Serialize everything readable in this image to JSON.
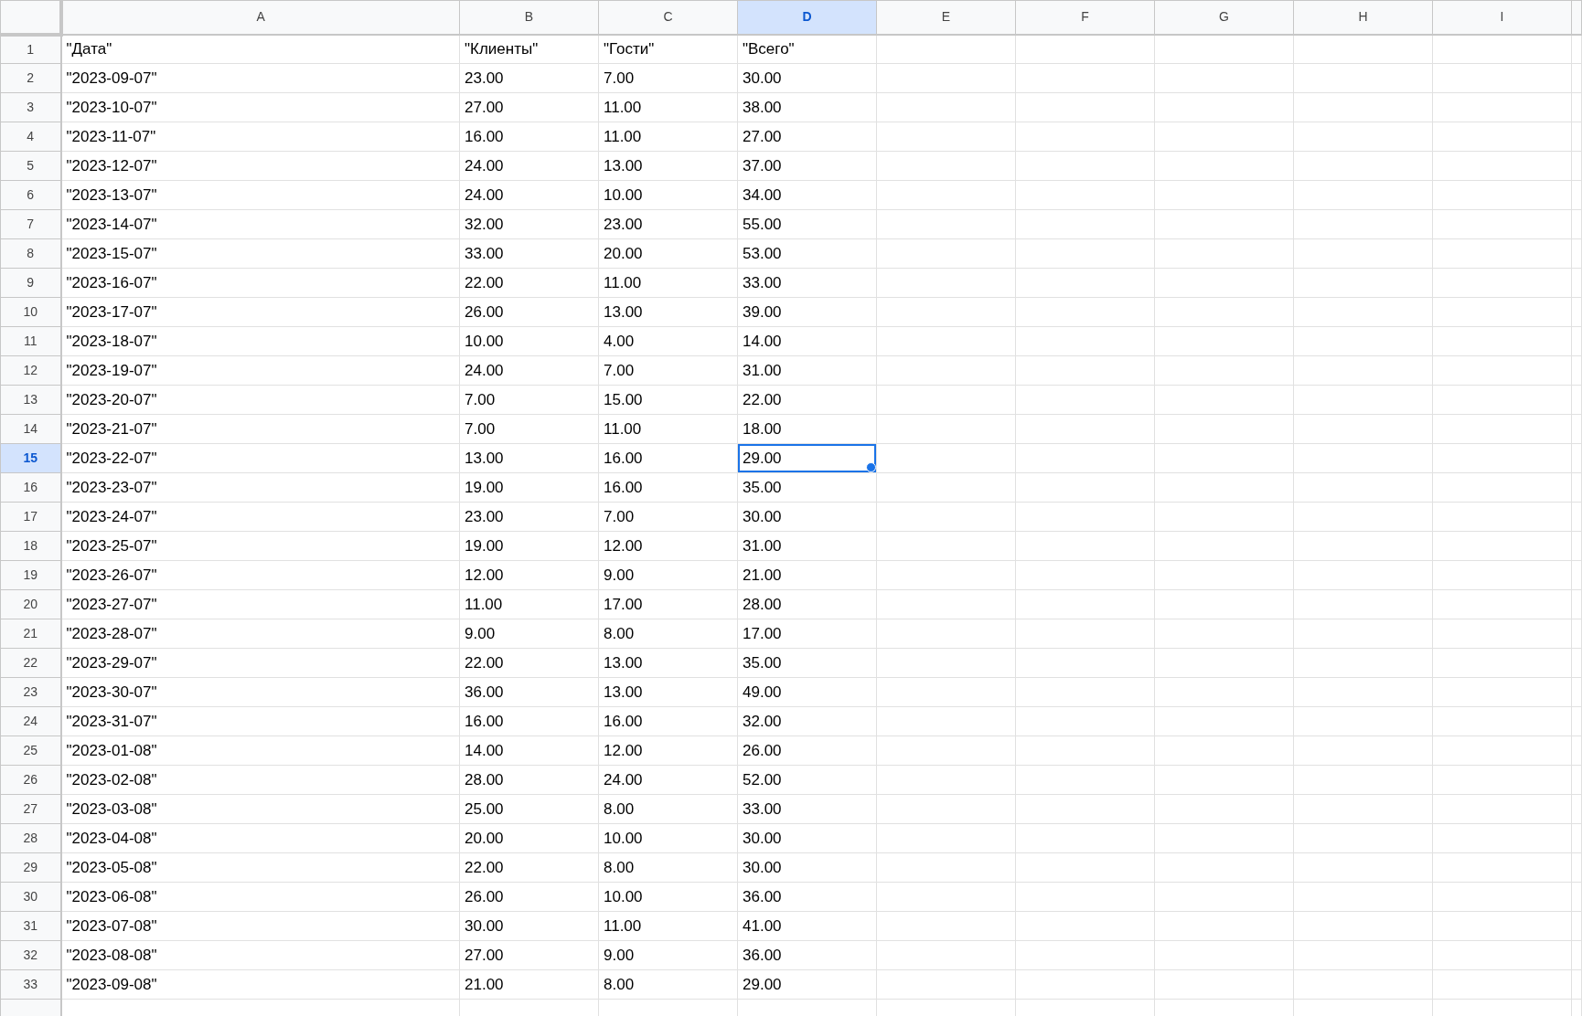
{
  "columns": [
    {
      "label": "A",
      "selected": false
    },
    {
      "label": "B",
      "selected": false
    },
    {
      "label": "C",
      "selected": false
    },
    {
      "label": "D",
      "selected": true
    },
    {
      "label": "E",
      "selected": false
    },
    {
      "label": "F",
      "selected": false
    },
    {
      "label": "G",
      "selected": false
    },
    {
      "label": "H",
      "selected": false
    },
    {
      "label": "I",
      "selected": false
    }
  ],
  "rows": [
    {
      "number": "1",
      "selected": false,
      "cells": [
        "\"Дата\"",
        "\"Клиенты\"",
        "\"Гости\"",
        "\"Всего\""
      ]
    },
    {
      "number": "2",
      "selected": false,
      "cells": [
        "\"2023-09-07\"",
        "23.00",
        "7.00",
        "30.00"
      ]
    },
    {
      "number": "3",
      "selected": false,
      "cells": [
        "\"2023-10-07\"",
        "27.00",
        "11.00",
        "38.00"
      ]
    },
    {
      "number": "4",
      "selected": false,
      "cells": [
        "\"2023-11-07\"",
        "16.00",
        "11.00",
        "27.00"
      ]
    },
    {
      "number": "5",
      "selected": false,
      "cells": [
        "\"2023-12-07\"",
        "24.00",
        "13.00",
        "37.00"
      ]
    },
    {
      "number": "6",
      "selected": false,
      "cells": [
        "\"2023-13-07\"",
        "24.00",
        "10.00",
        "34.00"
      ]
    },
    {
      "number": "7",
      "selected": false,
      "cells": [
        "\"2023-14-07\"",
        "32.00",
        "23.00",
        "55.00"
      ]
    },
    {
      "number": "8",
      "selected": false,
      "cells": [
        "\"2023-15-07\"",
        "33.00",
        "20.00",
        "53.00"
      ]
    },
    {
      "number": "9",
      "selected": false,
      "cells": [
        "\"2023-16-07\"",
        "22.00",
        "11.00",
        "33.00"
      ]
    },
    {
      "number": "10",
      "selected": false,
      "cells": [
        "\"2023-17-07\"",
        "26.00",
        "13.00",
        "39.00"
      ]
    },
    {
      "number": "11",
      "selected": false,
      "cells": [
        "\"2023-18-07\"",
        "10.00",
        "4.00",
        "14.00"
      ]
    },
    {
      "number": "12",
      "selected": false,
      "cells": [
        "\"2023-19-07\"",
        "24.00",
        "7.00",
        "31.00"
      ]
    },
    {
      "number": "13",
      "selected": false,
      "cells": [
        "\"2023-20-07\"",
        "7.00",
        "15.00",
        "22.00"
      ]
    },
    {
      "number": "14",
      "selected": false,
      "cells": [
        "\"2023-21-07\"",
        "7.00",
        "11.00",
        "18.00"
      ]
    },
    {
      "number": "15",
      "selected": true,
      "cells": [
        "\"2023-22-07\"",
        "13.00",
        "16.00",
        "29.00"
      ]
    },
    {
      "number": "16",
      "selected": false,
      "cells": [
        "\"2023-23-07\"",
        "19.00",
        "16.00",
        "35.00"
      ]
    },
    {
      "number": "17",
      "selected": false,
      "cells": [
        "\"2023-24-07\"",
        "23.00",
        "7.00",
        "30.00"
      ]
    },
    {
      "number": "18",
      "selected": false,
      "cells": [
        "\"2023-25-07\"",
        "19.00",
        "12.00",
        "31.00"
      ]
    },
    {
      "number": "19",
      "selected": false,
      "cells": [
        "\"2023-26-07\"",
        "12.00",
        "9.00",
        "21.00"
      ]
    },
    {
      "number": "20",
      "selected": false,
      "cells": [
        "\"2023-27-07\"",
        "11.00",
        "17.00",
        "28.00"
      ]
    },
    {
      "number": "21",
      "selected": false,
      "cells": [
        "\"2023-28-07\"",
        "9.00",
        "8.00",
        "17.00"
      ]
    },
    {
      "number": "22",
      "selected": false,
      "cells": [
        "\"2023-29-07\"",
        "22.00",
        "13.00",
        "35.00"
      ]
    },
    {
      "number": "23",
      "selected": false,
      "cells": [
        "\"2023-30-07\"",
        "36.00",
        "13.00",
        "49.00"
      ]
    },
    {
      "number": "24",
      "selected": false,
      "cells": [
        "\"2023-31-07\"",
        "16.00",
        "16.00",
        "32.00"
      ]
    },
    {
      "number": "25",
      "selected": false,
      "cells": [
        "\"2023-01-08\"",
        "14.00",
        "12.00",
        "26.00"
      ]
    },
    {
      "number": "26",
      "selected": false,
      "cells": [
        "\"2023-02-08\"",
        "28.00",
        "24.00",
        "52.00"
      ]
    },
    {
      "number": "27",
      "selected": false,
      "cells": [
        "\"2023-03-08\"",
        "25.00",
        "8.00",
        "33.00"
      ]
    },
    {
      "number": "28",
      "selected": false,
      "cells": [
        "\"2023-04-08\"",
        "20.00",
        "10.00",
        "30.00"
      ]
    },
    {
      "number": "29",
      "selected": false,
      "cells": [
        "\"2023-05-08\"",
        "22.00",
        "8.00",
        "30.00"
      ]
    },
    {
      "number": "30",
      "selected": false,
      "cells": [
        "\"2023-06-08\"",
        "26.00",
        "10.00",
        "36.00"
      ]
    },
    {
      "number": "31",
      "selected": false,
      "cells": [
        "\"2023-07-08\"",
        "30.00",
        "11.00",
        "41.00"
      ]
    },
    {
      "number": "32",
      "selected": false,
      "cells": [
        "\"2023-08-08\"",
        "27.00",
        "9.00",
        "36.00"
      ]
    },
    {
      "number": "33",
      "selected": false,
      "cells": [
        "\"2023-09-08\"",
        "21.00",
        "8.00",
        "29.00"
      ]
    },
    {
      "selected": false
    }
  ]
}
